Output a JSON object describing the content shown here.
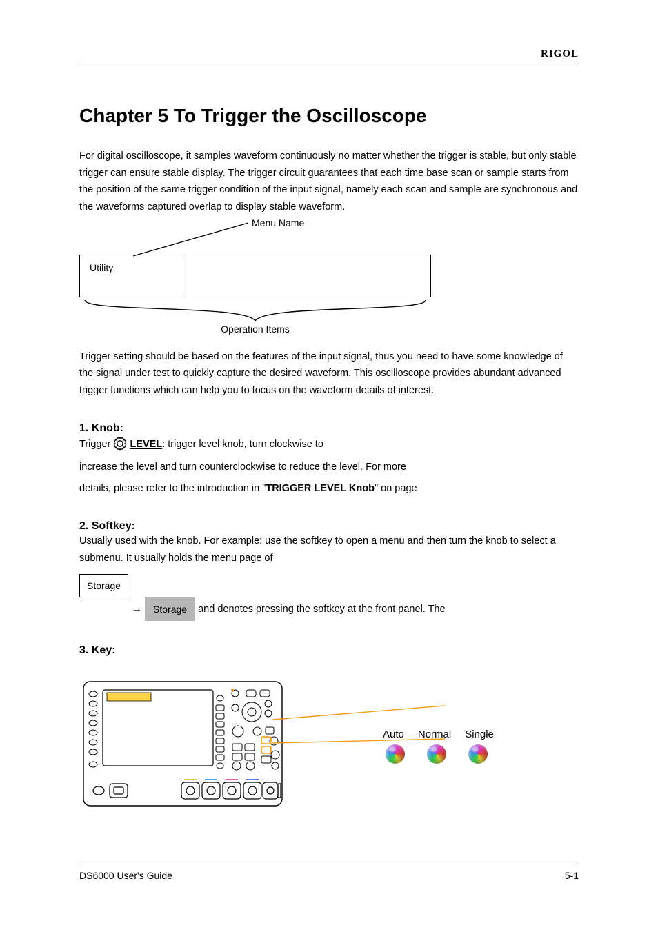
{
  "brand": "RIGOL",
  "chapter_title": "Chapter 5  To Trigger the Oscilloscope",
  "intro": "For digital oscilloscope, it samples waveform continuously no matter whether the trigger is stable, but only stable trigger can ensure stable display. The trigger circuit guarantees that each time base scan or sample starts from the position of the same trigger condition of the input signal, namely each scan and sample are synchronous and the waveforms captured overlap to display stable waveform.",
  "intro2": "Trigger setting should be based on the features of the input signal, thus you need to have some knowledge of the signal under test to quickly capture the desired waveform. This oscilloscope provides abundant advanced trigger functions which can help you to focus on the waveform details of interest.",
  "pointer_label": "Menu Name",
  "menu_row": {
    "left": "Utility",
    "right": " "
  },
  "operation_items_label": "Operation Items",
  "sec1": {
    "head": "1.   Knob:",
    "line1_a": "Trigger ",
    "line1_b": "LEVEL",
    "line1_c": ": trigger level knob, turn clockwise to",
    "line2": "increase the level and turn counterclockwise to reduce the level. For more",
    "line3_a": "details, please refer to the introduction in ",
    "line3_b": "\"",
    "line3_key": "TRIGGER LEVEL Knob",
    "line3_c": "\"",
    "line3_d": " on page"
  },
  "sec2": {
    "head": "2.   Softkey:",
    "intro1": "Usually used with the knob. For example: use the softkey to open a menu and then turn the knob to select a submenu. It usually holds the menu page of",
    "keycap": "Storage",
    "arrow": "→",
    "soft": "Storage",
    "tail": " and denotes pressing the softkey at the front panel. The"
  },
  "sec3": {
    "head": "3.   Key:",
    "labels": [
      "Auto",
      "Normal",
      "Single"
    ]
  },
  "footer_left": "DS6000 User's Guide",
  "footer_right": "5-1"
}
